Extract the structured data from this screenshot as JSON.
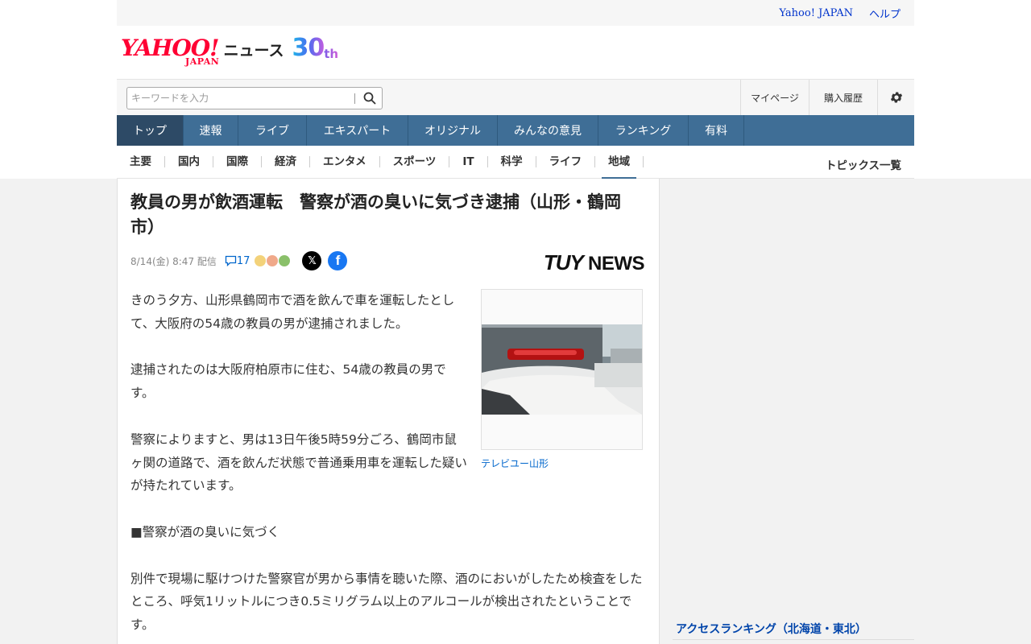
{
  "utility": {
    "yahoo_japan": "Yahoo! JAPAN",
    "help": "ヘルプ"
  },
  "logo": {
    "yahoo": "YAHOO!",
    "japan": "JAPAN",
    "news": "ニュース",
    "anniv": "30",
    "anniv_suffix": "th"
  },
  "search": {
    "placeholder": "キーワードを入力",
    "mypage": "マイページ",
    "history": "購入履歴"
  },
  "nav": {
    "items": [
      {
        "label": "トップ",
        "width": 83
      },
      {
        "label": "速報",
        "width": 68
      },
      {
        "label": "ライブ",
        "width": 85
      },
      {
        "label": "エキスパート",
        "width": 126
      },
      {
        "label": "オリジナル",
        "width": 111
      },
      {
        "label": "みんなの意見",
        "width": 125
      },
      {
        "label": "ランキング",
        "width": 112
      },
      {
        "label": "有料",
        "width": 69
      }
    ],
    "active_index": 0
  },
  "subnav": {
    "items": [
      "主要",
      "国内",
      "国際",
      "経済",
      "エンタメ",
      "スポーツ",
      "IT",
      "科学",
      "ライフ",
      "地域"
    ],
    "active_index": 9,
    "topics": "トピックス一覧"
  },
  "article": {
    "title": "教員の男が飲酒運転　警察が酒の臭いに気づき逮捕（山形・鶴岡市）",
    "date": "8/14(金) 8:47 配信",
    "comments": "17",
    "provider_logo_a": "TUY",
    "provider_logo_b": "NEWS",
    "photo_caption": "テレビユー山形",
    "paragraphs": [
      "きのう夕方、山形県鶴岡市で酒を飲んで車を運転したとして、大阪府の54歳の教員の男が逮捕されました。",
      "逮捕されたのは大阪府柏原市に住む、54歳の教員の男です。",
      "警察によりますと、男は13日午後5時59分ごろ、鶴岡市鼠ヶ関の道路で、酒を飲んだ状態で普通乗用車を運転した疑いが持たれています。",
      "■警察が酒の臭いに気づく",
      "別件で現場に駆けつけた警察官が男から事情を聴いた際、酒のにおいがしたため検査をしたところ、呼気1リットルにつき0.5ミリグラム以上のアルコールが検出されたということです。"
    ]
  },
  "sidebar": {
    "ranking_title": "アクセスランキング（北海道・東北）"
  },
  "colors": {
    "nav_bg": "#3f6e96",
    "nav_active": "#2d4a66",
    "link": "#0066cc",
    "brand_red": "#ff0033"
  }
}
